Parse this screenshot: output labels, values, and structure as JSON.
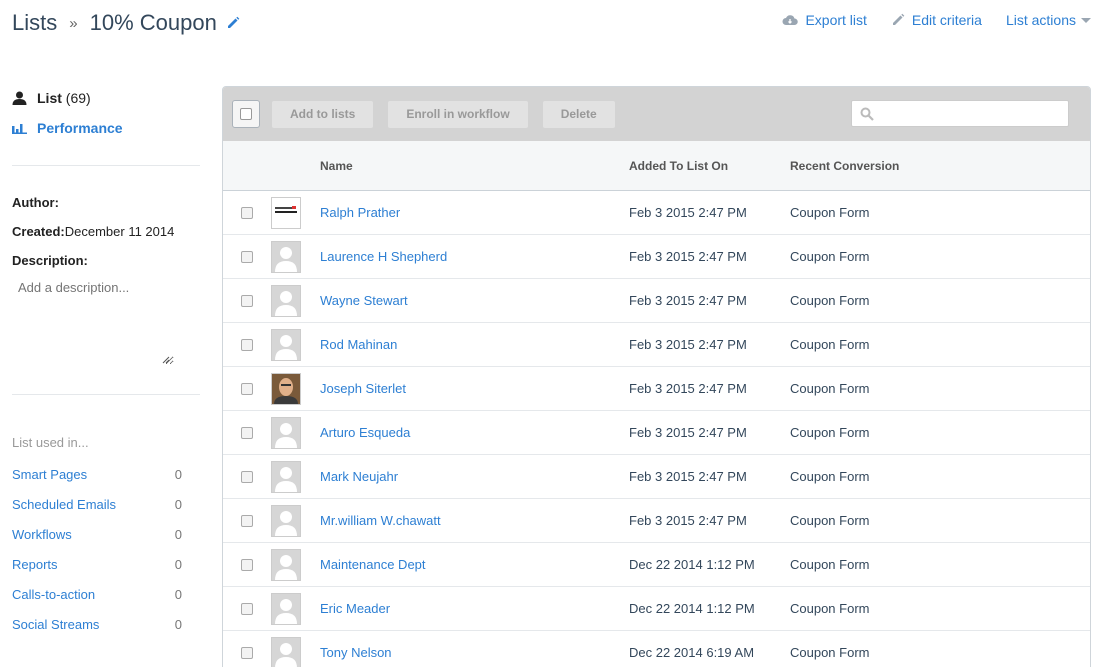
{
  "header": {
    "crumb": "Lists",
    "separator": "»",
    "title": "10% Coupon",
    "actions": {
      "export": "Export list",
      "edit": "Edit criteria",
      "list_actions": "List actions"
    }
  },
  "sidebar": {
    "list_label": "List",
    "list_count": "(69)",
    "performance_label": "Performance",
    "author_label": "Author:",
    "created_label": "Created:",
    "created_value": "December 11 2014",
    "description_label": "Description:",
    "description_placeholder": "Add a description...",
    "used_in_title": "List used in...",
    "used_in": [
      {
        "label": "Smart Pages",
        "count": "0"
      },
      {
        "label": "Scheduled Emails",
        "count": "0"
      },
      {
        "label": "Workflows",
        "count": "0"
      },
      {
        "label": "Reports",
        "count": "0"
      },
      {
        "label": "Calls-to-action",
        "count": "0"
      },
      {
        "label": "Social Streams",
        "count": "0"
      }
    ]
  },
  "toolbar": {
    "add_to_lists": "Add to lists",
    "enroll": "Enroll in workflow",
    "delete": "Delete",
    "search_placeholder": ""
  },
  "table": {
    "columns": {
      "name": "Name",
      "added": "Added To List On",
      "conversion": "Recent Conversion"
    },
    "rows": [
      {
        "name": "Ralph Prather",
        "added": "Feb 3 2015 2:47 PM",
        "conversion": "Coupon Form",
        "avatar": "logo"
      },
      {
        "name": "Laurence H Shepherd",
        "added": "Feb 3 2015 2:47 PM",
        "conversion": "Coupon Form",
        "avatar": "default"
      },
      {
        "name": "Wayne Stewart",
        "added": "Feb 3 2015 2:47 PM",
        "conversion": "Coupon Form",
        "avatar": "default"
      },
      {
        "name": "Rod Mahinan",
        "added": "Feb 3 2015 2:47 PM",
        "conversion": "Coupon Form",
        "avatar": "default"
      },
      {
        "name": "Joseph Siterlet",
        "added": "Feb 3 2015 2:47 PM",
        "conversion": "Coupon Form",
        "avatar": "photo"
      },
      {
        "name": "Arturo Esqueda",
        "added": "Feb 3 2015 2:47 PM",
        "conversion": "Coupon Form",
        "avatar": "default"
      },
      {
        "name": "Mark Neujahr",
        "added": "Feb 3 2015 2:47 PM",
        "conversion": "Coupon Form",
        "avatar": "default"
      },
      {
        "name": "Mr.william W.chawatt",
        "added": "Feb 3 2015 2:47 PM",
        "conversion": "Coupon Form",
        "avatar": "default"
      },
      {
        "name": "Maintenance Dept",
        "added": "Dec 22 2014 1:12 PM",
        "conversion": "Coupon Form",
        "avatar": "default"
      },
      {
        "name": "Eric Meader",
        "added": "Dec 22 2014 1:12 PM",
        "conversion": "Coupon Form",
        "avatar": "default"
      },
      {
        "name": "Tony Nelson",
        "added": "Dec 22 2014 6:19 AM",
        "conversion": "Coupon Form",
        "avatar": "default"
      }
    ]
  },
  "colors": {
    "link": "#2d7fd3",
    "toolbar": "#d3d3d3"
  }
}
